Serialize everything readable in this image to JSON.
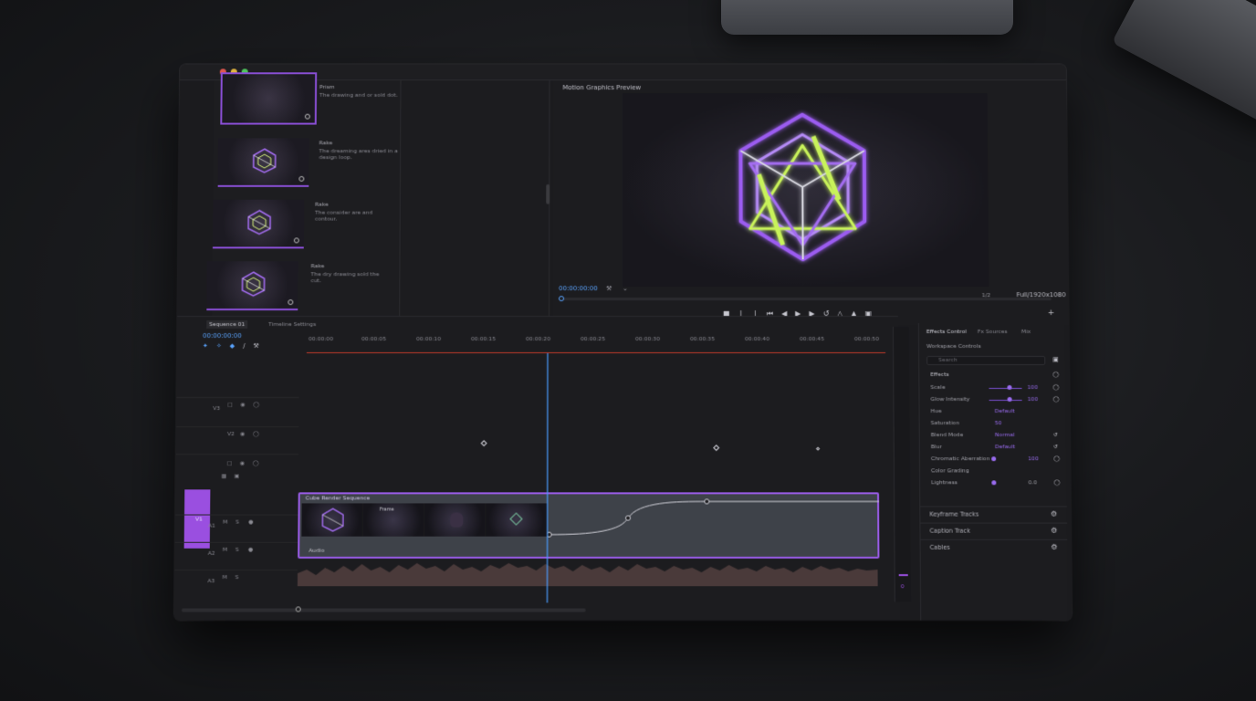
{
  "app": {
    "window_controls": [
      "close",
      "minimize",
      "zoom"
    ]
  },
  "media_bin": {
    "items": [
      {
        "name": "Prism",
        "desc": "The drawing and or sold dot.",
        "selected": true
      },
      {
        "name": "Rake",
        "desc": "The dreaming ares dried in a design loop.",
        "selected": false
      },
      {
        "name": "Rake",
        "desc": "The consider are and contour.",
        "selected": false
      },
      {
        "name": "Rake",
        "desc": "The dry drawing sold the cut.",
        "selected": false
      }
    ]
  },
  "preview": {
    "title": "Motion Graphics Preview",
    "timecode": "00:00:00:00",
    "fit_label": "1/2",
    "resolution": "Full/1920x1080",
    "transport": [
      "stop-icon",
      "mark-in-icon",
      "mark-out-icon",
      "go-start-icon",
      "step-back-icon",
      "play-icon",
      "step-forward-icon",
      "loop-icon",
      "insert-icon",
      "overwrite-icon",
      "export-frame-icon"
    ],
    "colors": {
      "cube_primary": "#9b5cf0",
      "cube_accent": "#c8f25a"
    }
  },
  "timeline": {
    "tabs": [
      "Sequence 01",
      "Timeline Settings"
    ],
    "current_time": "00:00:00:00",
    "ruler_ticks": [
      "00:00:00",
      "00:00:05",
      "00:00:10",
      "00:00:15",
      "00:00:20",
      "00:00:25",
      "00:00:30",
      "00:00:35",
      "00:00:40",
      "00:00:45",
      "00:00:50"
    ],
    "tracks": [
      {
        "id": "V3",
        "label": "V3",
        "controls": [
          "lock",
          "eye",
          "mute"
        ]
      },
      {
        "id": "V2",
        "label": "V2",
        "controls": [
          "lock",
          "eye",
          "mute"
        ]
      },
      {
        "id": "V1",
        "label": "V1",
        "controls": [
          "lock",
          "eye",
          "mute"
        ],
        "selected": true
      },
      {
        "id": "A1",
        "label": "A1",
        "controls": [
          "M",
          "S",
          "mic"
        ]
      },
      {
        "id": "A2",
        "label": "A2",
        "controls": [
          "M",
          "S",
          "mic"
        ]
      },
      {
        "id": "A3",
        "label": "A3",
        "controls": [
          "M",
          "S"
        ]
      }
    ],
    "clip": {
      "name": "Cube Render Sequence",
      "frame_label": "Frame"
    },
    "audio": {
      "name": "Audio"
    },
    "meter_value": "0",
    "colors": {
      "clip_border": "#9a5ce8",
      "playhead": "#4a9cff"
    }
  },
  "effects": {
    "tabs": [
      "Effects Control",
      "Fx Sources",
      "Mix"
    ],
    "subheader": "Workspace Controls",
    "search": {
      "placeholder": "Search"
    },
    "group_label": "Effects",
    "rows": [
      {
        "name": "Scale",
        "value": "100"
      },
      {
        "name": "Glow Intensity",
        "value": "100"
      },
      {
        "name": "Hue",
        "value": "Default"
      },
      {
        "name": "Saturation",
        "value": "50"
      },
      {
        "name": "Blend Mode",
        "value": "Normal"
      },
      {
        "name": "Blur",
        "value": "Default"
      },
      {
        "name": "Chromatic Aberration",
        "value": "100"
      },
      {
        "name": "Color Grading"
      },
      {
        "name": "Lightness",
        "value": "0.0"
      }
    ],
    "sections": [
      "Keyframe Tracks",
      "Caption Track",
      "Cables"
    ]
  }
}
